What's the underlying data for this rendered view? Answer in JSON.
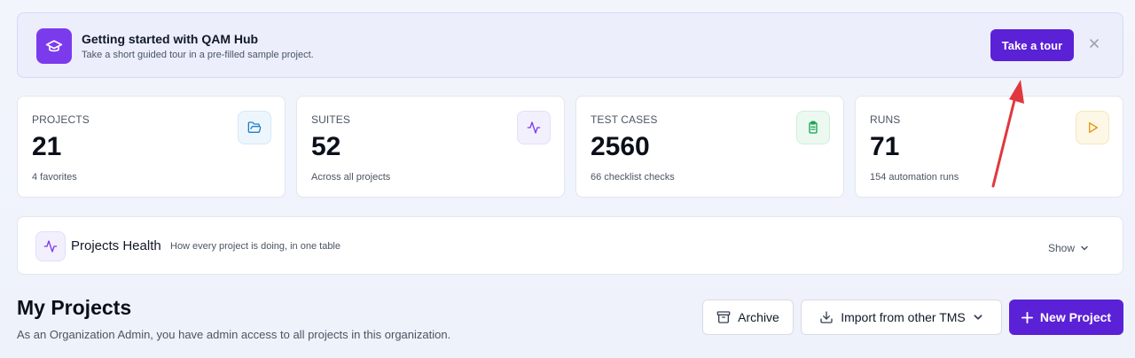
{
  "banner": {
    "title": "Getting started with QAM Hub",
    "subtitle": "Take a short guided tour in a pre-filled sample project.",
    "tour_button": "Take a tour",
    "icon": "graduation-cap-icon"
  },
  "stats": [
    {
      "label": "PROJECTS",
      "value": "21",
      "sub": "4 favorites",
      "icon": "folder-open-icon"
    },
    {
      "label": "SUITES",
      "value": "52",
      "sub": "Across all projects",
      "icon": "activity-icon"
    },
    {
      "label": "TEST CASES",
      "value": "2560",
      "sub": "66 checklist checks",
      "icon": "clipboard-check-icon"
    },
    {
      "label": "RUNS",
      "value": "71",
      "sub": "154 automation runs",
      "icon": "play-icon"
    }
  ],
  "health": {
    "title": "Projects Health",
    "subtitle": "How every project is doing, in one table",
    "toggle": "Show"
  },
  "projects": {
    "title": "My Projects",
    "subtitle": "As an Organization Admin, you have admin access to all projects in this organization.",
    "archive_button": "Archive",
    "import_button": "Import from other TMS",
    "new_button": "New Project"
  },
  "colors": {
    "accent": "#5b21d6",
    "banner_icon": "#7c3aed",
    "annotation_arrow": "#e0383e"
  }
}
